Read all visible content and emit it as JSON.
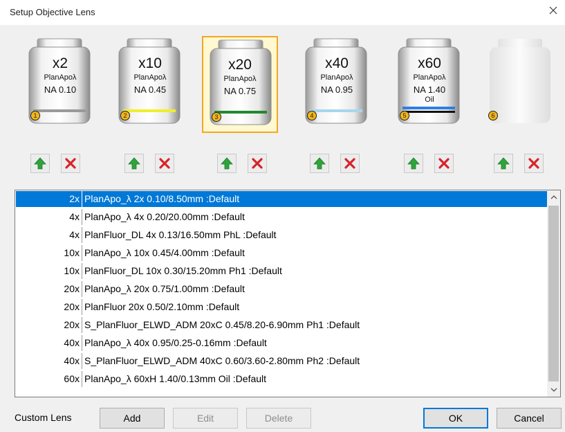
{
  "window": {
    "title": "Setup Objective Lens"
  },
  "turret": [
    {
      "slot": "1",
      "magnification": "x2",
      "type": "PlanApoλ",
      "na": "NA 0.10",
      "immersion": "",
      "band_color": "#999999",
      "selected": false,
      "empty": false
    },
    {
      "slot": "2",
      "magnification": "x10",
      "type": "PlanApoλ",
      "na": "NA 0.45",
      "immersion": "",
      "band_color": "#f2ee2a",
      "selected": false,
      "empty": false
    },
    {
      "slot": "3",
      "magnification": "x20",
      "type": "PlanApoλ",
      "na": "NA 0.75",
      "immersion": "",
      "band_color": "#1f8a2c",
      "selected": true,
      "empty": false
    },
    {
      "slot": "4",
      "magnification": "x40",
      "type": "PlanApoλ",
      "na": "NA 0.95",
      "immersion": "",
      "band_color": "#a8d6ee",
      "selected": false,
      "empty": false
    },
    {
      "slot": "5",
      "magnification": "x60",
      "type": "PlanApoλ",
      "na": "NA 1.40",
      "immersion": "Oil",
      "band_color": "#2d7fe0",
      "selected": false,
      "empty": false
    },
    {
      "slot": "6",
      "magnification": "",
      "type": "",
      "na": "",
      "immersion": "",
      "band_color": "",
      "selected": false,
      "empty": true
    }
  ],
  "lens_list": [
    {
      "mag": "2x",
      "name": "PlanApo_λ 2x 0.10/8.50mm :Default",
      "selected": true
    },
    {
      "mag": "4x",
      "name": "PlanApo_λ 4x 0.20/20.00mm :Default",
      "selected": false
    },
    {
      "mag": "4x",
      "name": "PlanFluor_DL 4x 0.13/16.50mm PhL :Default",
      "selected": false
    },
    {
      "mag": "10x",
      "name": "PlanApo_λ 10x 0.45/4.00mm :Default",
      "selected": false
    },
    {
      "mag": "10x",
      "name": "PlanFluor_DL 10x 0.30/15.20mm Ph1 :Default",
      "selected": false
    },
    {
      "mag": "20x",
      "name": "PlanApo_λ 20x 0.75/1.00mm :Default",
      "selected": false
    },
    {
      "mag": "20x",
      "name": "PlanFluor 20x 0.50/2.10mm :Default",
      "selected": false
    },
    {
      "mag": "20x",
      "name": "S_PlanFluor_ELWD_ADM 20xC 0.45/8.20-6.90mm Ph1 :Default",
      "selected": false
    },
    {
      "mag": "40x",
      "name": "PlanApo_λ 40x 0.95/0.25-0.16mm :Default",
      "selected": false
    },
    {
      "mag": "40x",
      "name": "S_PlanFluor_ELWD_ADM 40xC 0.60/3.60-2.80mm Ph2 :Default",
      "selected": false
    },
    {
      "mag": "60x",
      "name": "PlanApo_λ 60xH 1.40/0.13mm Oil :Default",
      "selected": false
    }
  ],
  "footer": {
    "custom_lens_label": "Custom Lens",
    "add_label": "Add",
    "edit_label": "Edit",
    "delete_label": "Delete",
    "ok_label": "OK",
    "cancel_label": "Cancel"
  },
  "colors": {
    "selection": "#0078d7",
    "selected_slot_border": "#f5a623",
    "arrow_green": "#2ea43a",
    "remove_red": "#d8232a"
  }
}
